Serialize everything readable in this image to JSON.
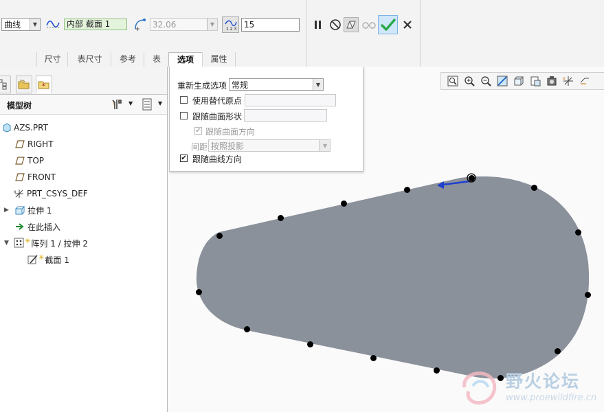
{
  "dashboard": {
    "curve_type": "曲线",
    "section_ref": "内部 截面 1",
    "distance_value": "32.06",
    "count_value": "15",
    "tabs": [
      {
        "label": "尺寸"
      },
      {
        "label": "表尺寸"
      },
      {
        "label": "参考"
      },
      {
        "label": "表"
      },
      {
        "label": "选项"
      },
      {
        "label": "属性"
      }
    ]
  },
  "options_panel": {
    "regen_label": "重新生成选项",
    "regen_value": "常规",
    "alt_origin_label": "使用替代原点",
    "follow_surface_shape_label": "跟随曲面形状",
    "follow_surface_dir_label": "跟随曲面方向",
    "spacing_label": "间距",
    "spacing_value": "按照投影",
    "follow_curve_dir_label": "跟随曲线方向",
    "follow_curve_dir_checked": true,
    "follow_surface_dir_checked": true
  },
  "model_tree": {
    "title": "模型树",
    "items": [
      {
        "label": "AZS.PRT",
        "icon": "part-icon"
      },
      {
        "label": "RIGHT",
        "icon": "datum-plane-icon"
      },
      {
        "label": "TOP",
        "icon": "datum-plane-icon"
      },
      {
        "label": "FRONT",
        "icon": "datum-plane-icon"
      },
      {
        "label": "PRT_CSYS_DEF",
        "icon": "csys-icon"
      },
      {
        "label": "拉伸 1",
        "icon": "extrude-icon"
      },
      {
        "label": "在此插入",
        "icon": "insert-arrow-icon"
      },
      {
        "label": "阵列 1 / 拉伸 2",
        "icon": "pattern-icon"
      },
      {
        "label": "截面 1",
        "icon": "sketch-icon"
      }
    ]
  },
  "watermark": {
    "site_name": "野火论坛",
    "url": "www.proewildfire.cn"
  },
  "colors": {
    "shape_fill": "#8b919b",
    "arrow": "#1f3fcf",
    "accept": "#2aa84a"
  }
}
